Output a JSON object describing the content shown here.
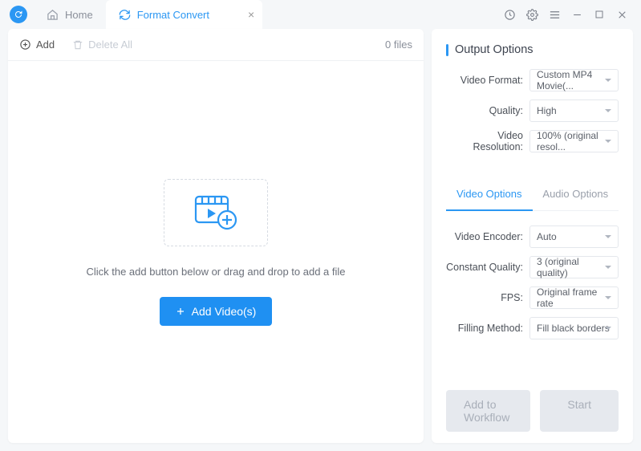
{
  "tabs": {
    "home": "Home",
    "convert": "Format Convert"
  },
  "leftToolbar": {
    "add": "Add",
    "deleteAll": "Delete All",
    "fileCount": "0 files"
  },
  "dropzone": {
    "hint": "Click the add button below or drag and drop to add a file",
    "addVideos": "Add Video(s)"
  },
  "output": {
    "title": "Output Options",
    "videoFormat": {
      "label": "Video Format:",
      "value": "Custom MP4 Movie(..."
    },
    "quality": {
      "label": "Quality:",
      "value": "High"
    },
    "resolution": {
      "label": "Video Resolution:",
      "value": "100% (original resol..."
    }
  },
  "subtabs": {
    "video": "Video Options",
    "audio": "Audio Options"
  },
  "videoOptions": {
    "encoder": {
      "label": "Video Encoder:",
      "value": "Auto"
    },
    "cq": {
      "label": "Constant Quality:",
      "value": "3 (original quality)"
    },
    "fps": {
      "label": "FPS:",
      "value": "Original frame rate"
    },
    "filling": {
      "label": "Filling Method:",
      "value": "Fill black borders"
    }
  },
  "footer": {
    "workflow": "Add to Workflow",
    "start": "Start"
  }
}
